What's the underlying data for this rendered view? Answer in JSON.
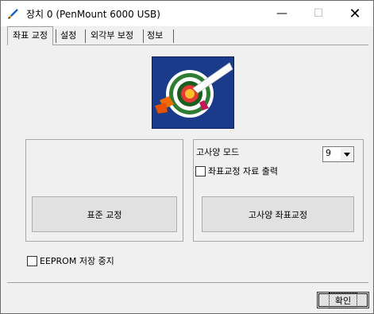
{
  "window": {
    "title": "장치 0 (PenMount 6000 USB)",
    "controls": {
      "minimize": "—",
      "maximize": "☐",
      "close": "✕"
    }
  },
  "tabs": [
    {
      "label": "좌표 교정",
      "active": true
    },
    {
      "label": "설정",
      "active": false
    },
    {
      "label": "외각부 보정",
      "active": false
    },
    {
      "label": "정보",
      "active": false
    }
  ],
  "calibration": {
    "standard_button": "표준 교정",
    "advanced_mode_label": "고사양 모드",
    "advanced_mode_value": "9",
    "output_checkbox_label": "좌표교정 자료 출력",
    "output_checked": false,
    "advanced_button": "고사양 좌표교정",
    "eeprom_checkbox_label": "EEPROM 저장 중지",
    "eeprom_checked": false
  },
  "footer": {
    "ok_button": "확인"
  },
  "icons": {
    "app": "pen-icon",
    "target": "target-calibration-icon",
    "dropdown": "chevron-down-icon"
  },
  "colors": {
    "image_bg": "#1a3a8a",
    "accent": "#2e7d32"
  }
}
